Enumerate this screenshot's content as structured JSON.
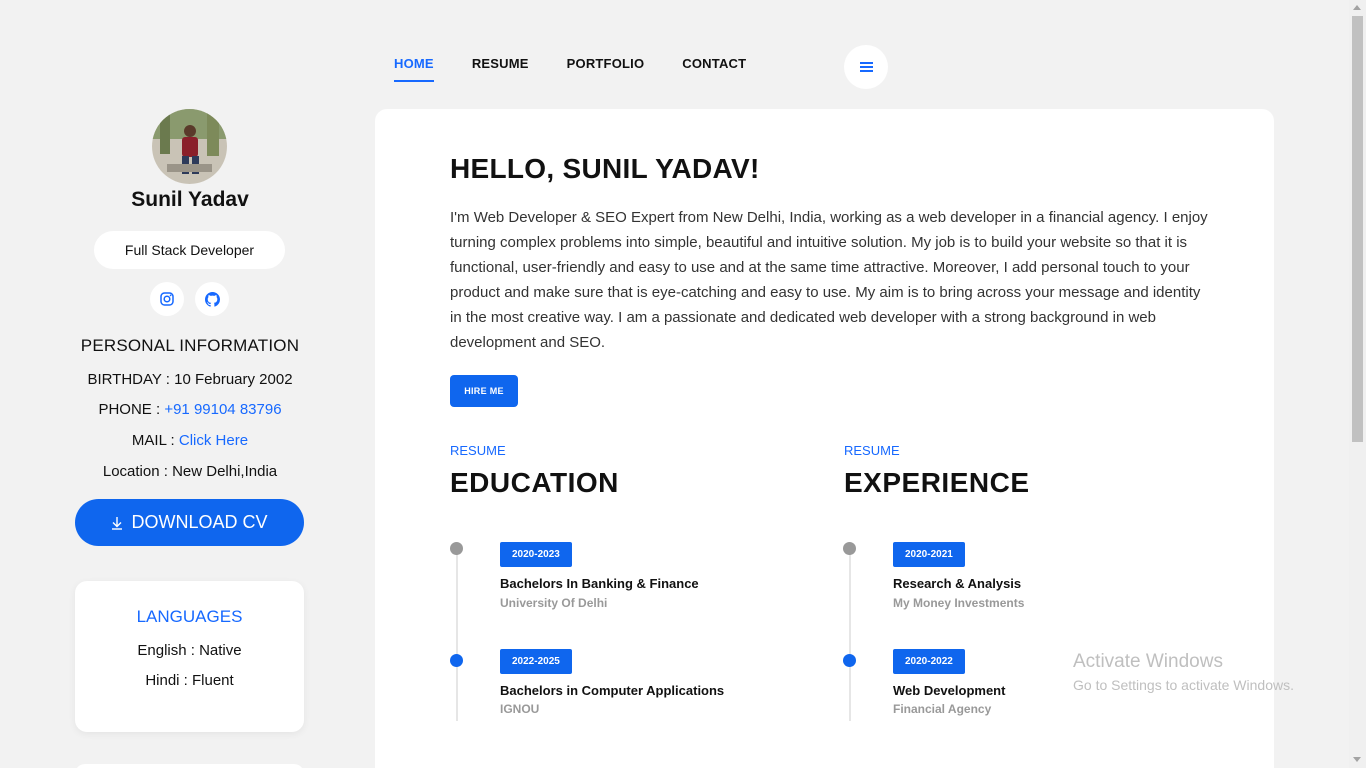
{
  "profile": {
    "name": "Sunil Yadav",
    "role": "Full Stack Developer"
  },
  "personal_info": {
    "title": "PERSONAL INFORMATION",
    "birthday_label": "BIRTHDAY : ",
    "birthday_value": "10 February 2002",
    "phone_label": "PHONE : ",
    "phone_value": "+91 99104 83796",
    "mail_label": "MAIL : ",
    "mail_value": "Click Here",
    "location_label": "Location : ",
    "location_value": "New Delhi,India"
  },
  "download_label": "DOWNLOAD CV",
  "languages": {
    "title": "LANGUAGES",
    "items": [
      "English : Native",
      "Hindi : Fluent"
    ]
  },
  "nav": {
    "items": [
      "HOME",
      "RESUME",
      "PORTFOLIO",
      "CONTACT"
    ]
  },
  "main": {
    "greeting": "HELLO, SUNIL YADAV!",
    "about": "I'm Web Developer & SEO Expert from New Delhi, India, working as a web developer in a financial agency. I enjoy turning complex problems into simple, beautiful and intuitive solution. My job is to build your website so that it is functional, user-friendly and easy to use and at the same time attractive. Moreover, I add personal touch to your product and make sure that is eye-catching and easy to use. My aim is to bring across your message and identity in the most creative way. I am a passionate and dedicated web developer with a strong background in web development and SEO.",
    "hire_label": "HIRE ME"
  },
  "education": {
    "label": "RESUME",
    "title": "EDUCATION",
    "items": [
      {
        "years": "2020-2023",
        "title": "Bachelors In Banking & Finance",
        "org": "University Of Delhi"
      },
      {
        "years": "2022-2025",
        "title": "Bachelors in Computer Applications",
        "org": "IGNOU"
      }
    ]
  },
  "experience": {
    "label": "RESUME",
    "title": "EXPERIENCE",
    "items": [
      {
        "years": "2020-2021",
        "title": "Research & Analysis",
        "org": "My Money Investments"
      },
      {
        "years": "2020-2022",
        "title": "Web Development",
        "org": "Financial Agency"
      }
    ]
  },
  "watermark": {
    "line1": "Activate Windows",
    "line2": "Go to Settings to activate Windows."
  },
  "colors": {
    "accent": "#0f66ee",
    "background": "#f2f2f2"
  },
  "icons": [
    "instagram-icon",
    "github-icon",
    "download-icon",
    "hamburger-menu-icon"
  ]
}
